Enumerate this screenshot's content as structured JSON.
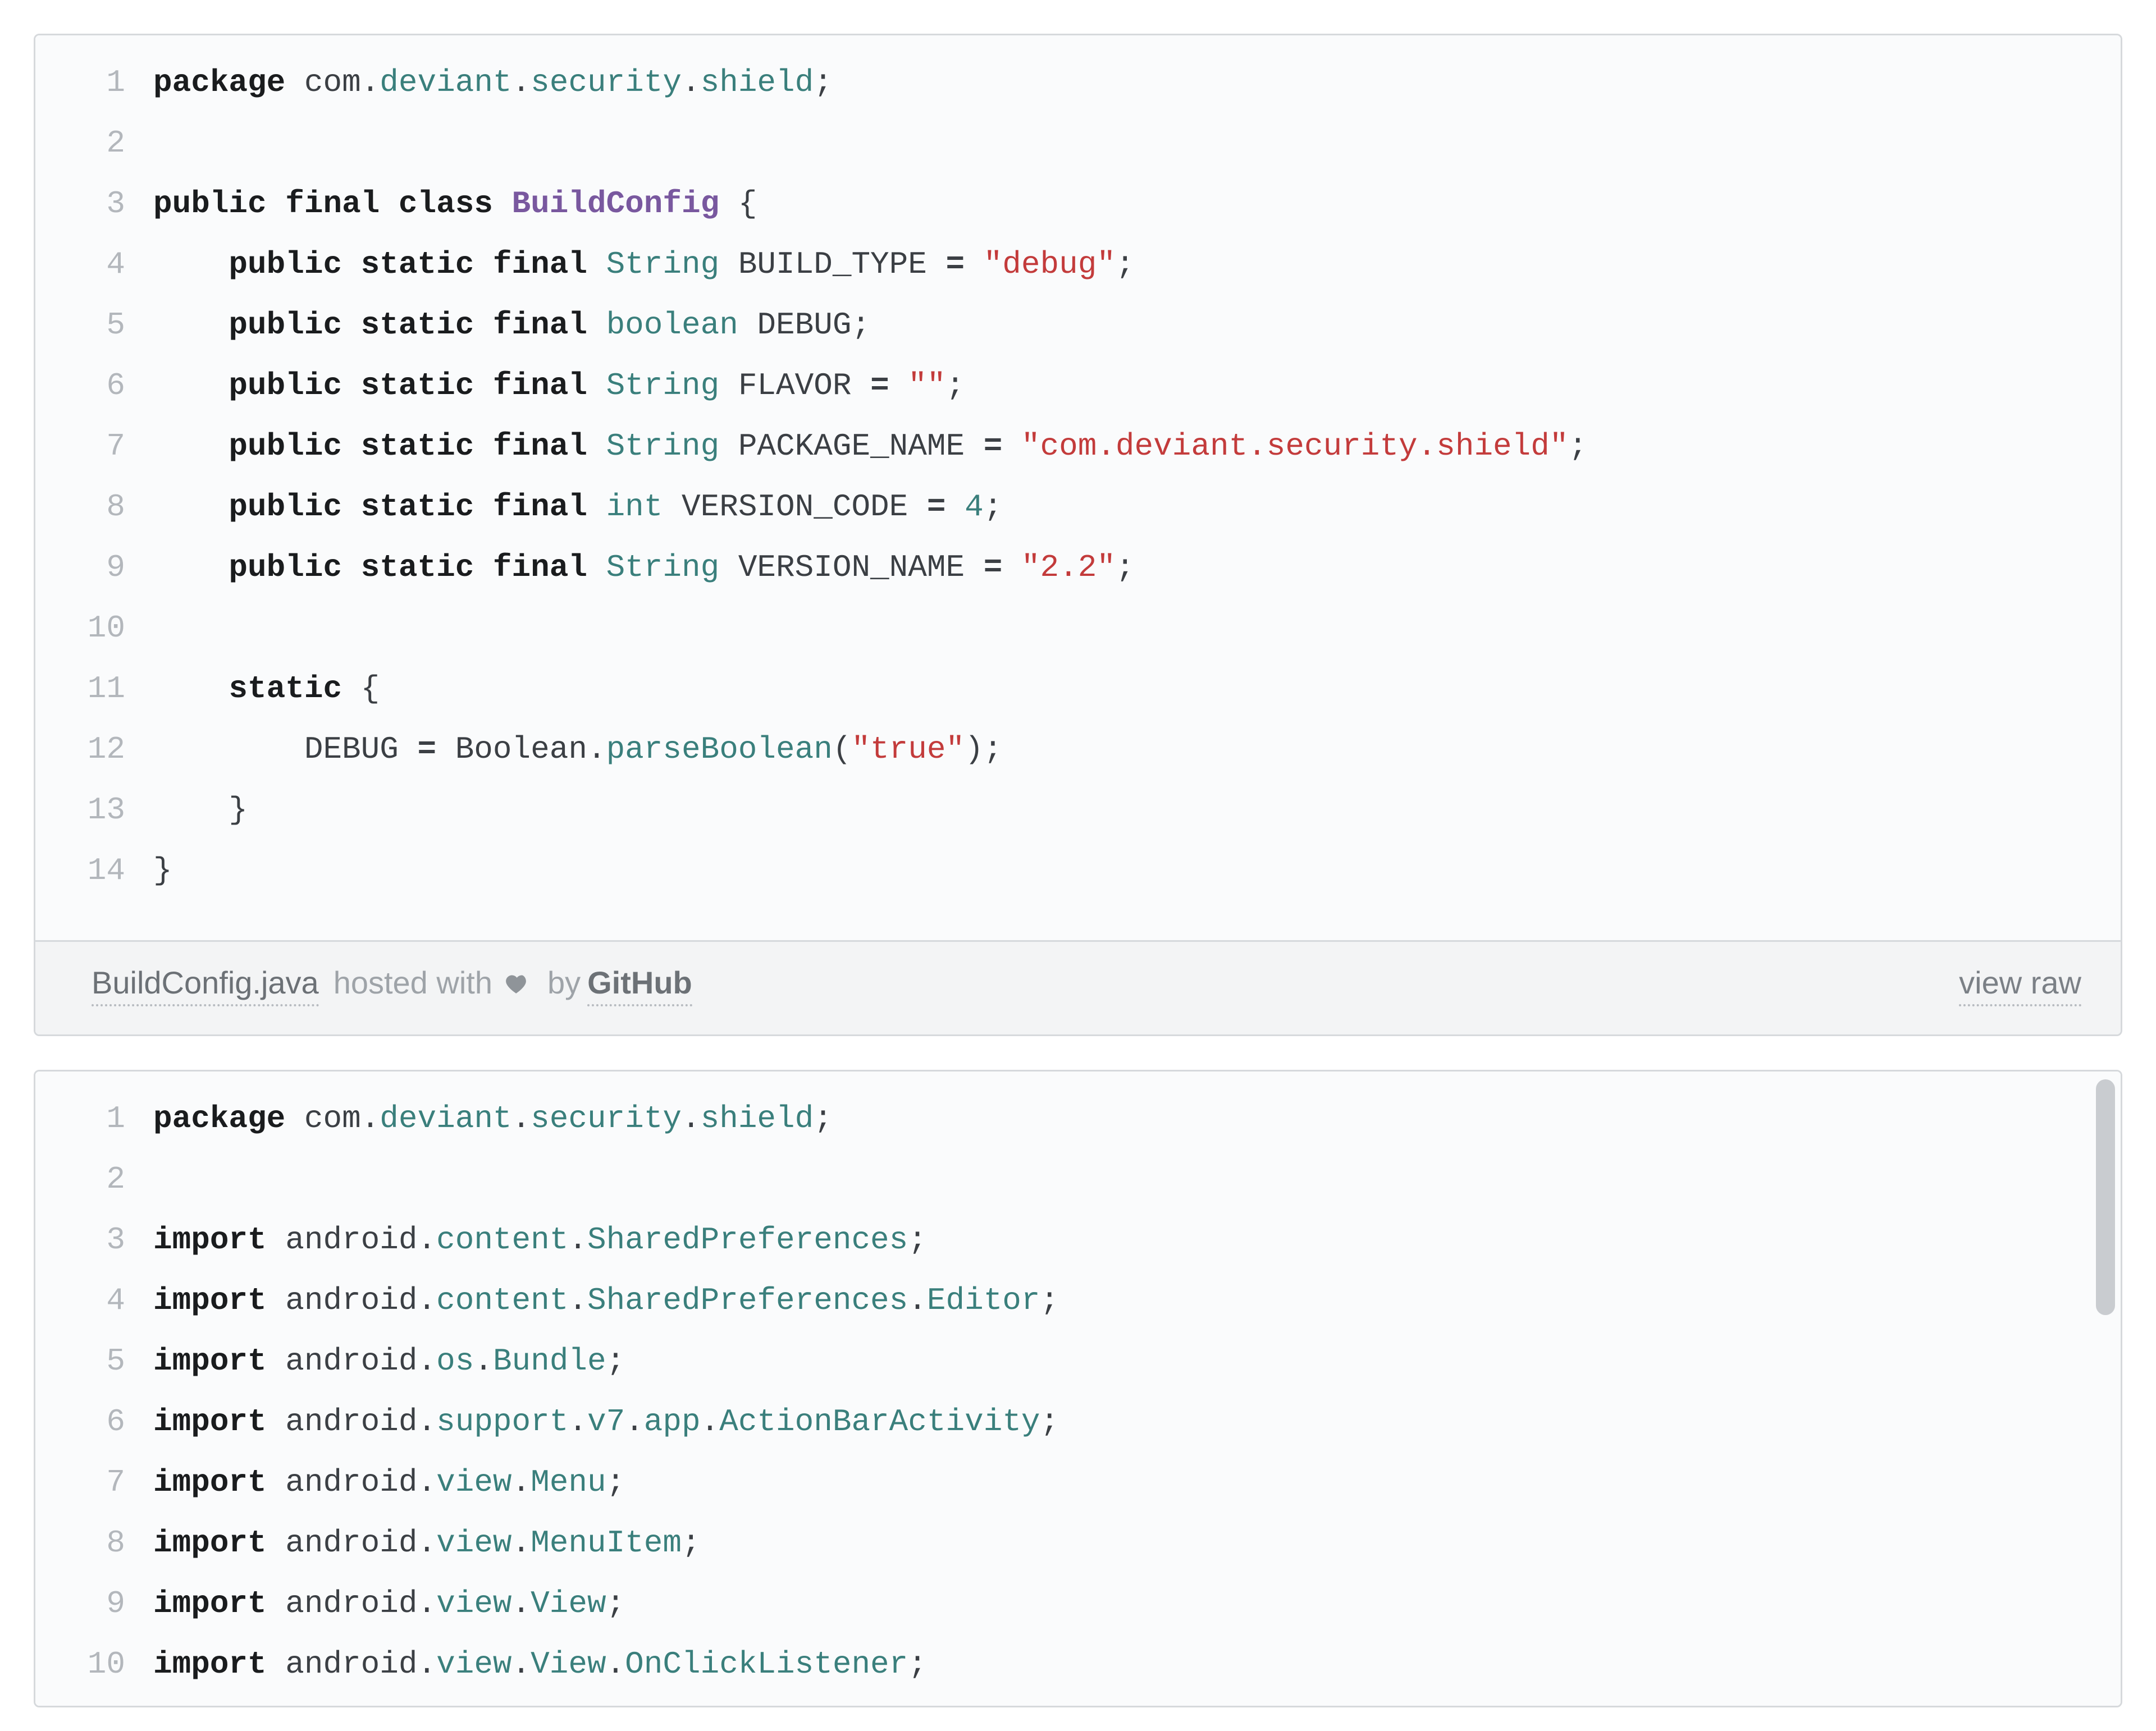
{
  "gists": [
    {
      "footer": {
        "filename": "BuildConfig.java",
        "hosted_prefix": " hosted with ",
        "by_text": " by ",
        "github": "GitHub",
        "view_raw": "view raw"
      },
      "lines": [
        {
          "n": "1",
          "html": "<span class='tok-kw'>package</span> <span class='tok-ident'>com</span><span class='tok-punc'>.</span><span class='tok-pkg'>deviant</span><span class='tok-punc'>.</span><span class='tok-pkg'>security</span><span class='tok-punc'>.</span><span class='tok-pkg'>shield</span><span class='tok-punc'>;</span>"
        },
        {
          "n": "2",
          "html": ""
        },
        {
          "n": "3",
          "html": "<span class='tok-kw'>public</span> <span class='tok-kw'>final</span> <span class='tok-kw'>class</span> <span class='tok-cls'>BuildConfig</span> <span class='tok-punc'>{</span>"
        },
        {
          "n": "4",
          "html": "    <span class='tok-kw'>public</span> <span class='tok-kw'>static</span> <span class='tok-kw'>final</span> <span class='tok-type'>String</span> <span class='tok-ident'>BUILD_TYPE</span> <span class='tok-op'>=</span> <span class='tok-str'>\"debug\"</span><span class='tok-punc'>;</span>"
        },
        {
          "n": "5",
          "html": "    <span class='tok-kw'>public</span> <span class='tok-kw'>static</span> <span class='tok-kw'>final</span> <span class='tok-type'>boolean</span> <span class='tok-ident'>DEBUG</span><span class='tok-punc'>;</span>"
        },
        {
          "n": "6",
          "html": "    <span class='tok-kw'>public</span> <span class='tok-kw'>static</span> <span class='tok-kw'>final</span> <span class='tok-type'>String</span> <span class='tok-ident'>FLAVOR</span> <span class='tok-op'>=</span> <span class='tok-str'>\"\"</span><span class='tok-punc'>;</span>"
        },
        {
          "n": "7",
          "html": "    <span class='tok-kw'>public</span> <span class='tok-kw'>static</span> <span class='tok-kw'>final</span> <span class='tok-type'>String</span> <span class='tok-ident'>PACKAGE_NAME</span> <span class='tok-op'>=</span> <span class='tok-str'>\"com.deviant.security.shield\"</span><span class='tok-punc'>;</span>"
        },
        {
          "n": "8",
          "html": "    <span class='tok-kw'>public</span> <span class='tok-kw'>static</span> <span class='tok-kw'>final</span> <span class='tok-type'>int</span> <span class='tok-ident'>VERSION_CODE</span> <span class='tok-op'>=</span> <span class='tok-num'>4</span><span class='tok-punc'>;</span>"
        },
        {
          "n": "9",
          "html": "    <span class='tok-kw'>public</span> <span class='tok-kw'>static</span> <span class='tok-kw'>final</span> <span class='tok-type'>String</span> <span class='tok-ident'>VERSION_NAME</span> <span class='tok-op'>=</span> <span class='tok-str'>\"2.2\"</span><span class='tok-punc'>;</span>"
        },
        {
          "n": "10",
          "html": ""
        },
        {
          "n": "11",
          "html": "    <span class='tok-kw'>static</span> <span class='tok-punc'>{</span>"
        },
        {
          "n": "12",
          "html": "        <span class='tok-ident'>DEBUG</span> <span class='tok-op'>=</span> <span class='tok-ident'>Boolean</span><span class='tok-punc'>.</span><span class='tok-call'>parseBoolean</span><span class='tok-punc'>(</span><span class='tok-str'>\"true\"</span><span class='tok-punc'>);</span>"
        },
        {
          "n": "13",
          "html": "    <span class='tok-punc'>}</span>"
        },
        {
          "n": "14",
          "html": "<span class='tok-punc'>}</span>"
        }
      ]
    },
    {
      "scrollable": true,
      "lines": [
        {
          "n": "1",
          "html": "<span class='tok-kw'>package</span> <span class='tok-ident'>com</span><span class='tok-punc'>.</span><span class='tok-pkg'>deviant</span><span class='tok-punc'>.</span><span class='tok-pkg'>security</span><span class='tok-punc'>.</span><span class='tok-pkg'>shield</span><span class='tok-punc'>;</span>"
        },
        {
          "n": "2",
          "html": ""
        },
        {
          "n": "3",
          "html": "<span class='tok-kw'>import</span> <span class='tok-ident'>android</span><span class='tok-punc'>.</span><span class='tok-pkg'>content</span><span class='tok-punc'>.</span><span class='tok-pkg'>SharedPreferences</span><span class='tok-punc'>;</span>"
        },
        {
          "n": "4",
          "html": "<span class='tok-kw'>import</span> <span class='tok-ident'>android</span><span class='tok-punc'>.</span><span class='tok-pkg'>content</span><span class='tok-punc'>.</span><span class='tok-pkg'>SharedPreferences</span><span class='tok-punc'>.</span><span class='tok-pkg'>Editor</span><span class='tok-punc'>;</span>"
        },
        {
          "n": "5",
          "html": "<span class='tok-kw'>import</span> <span class='tok-ident'>android</span><span class='tok-punc'>.</span><span class='tok-pkg'>os</span><span class='tok-punc'>.</span><span class='tok-pkg'>Bundle</span><span class='tok-punc'>;</span>"
        },
        {
          "n": "6",
          "html": "<span class='tok-kw'>import</span> <span class='tok-ident'>android</span><span class='tok-punc'>.</span><span class='tok-pkg'>support</span><span class='tok-punc'>.</span><span class='tok-pkg'>v7</span><span class='tok-punc'>.</span><span class='tok-pkg'>app</span><span class='tok-punc'>.</span><span class='tok-pkg'>ActionBarActivity</span><span class='tok-punc'>;</span>"
        },
        {
          "n": "7",
          "html": "<span class='tok-kw'>import</span> <span class='tok-ident'>android</span><span class='tok-punc'>.</span><span class='tok-pkg'>view</span><span class='tok-punc'>.</span><span class='tok-pkg'>Menu</span><span class='tok-punc'>;</span>"
        },
        {
          "n": "8",
          "html": "<span class='tok-kw'>import</span> <span class='tok-ident'>android</span><span class='tok-punc'>.</span><span class='tok-pkg'>view</span><span class='tok-punc'>.</span><span class='tok-pkg'>MenuItem</span><span class='tok-punc'>;</span>"
        },
        {
          "n": "9",
          "html": "<span class='tok-kw'>import</span> <span class='tok-ident'>android</span><span class='tok-punc'>.</span><span class='tok-pkg'>view</span><span class='tok-punc'>.</span><span class='tok-pkg'>View</span><span class='tok-punc'>;</span>"
        },
        {
          "n": "10",
          "html": "<span class='tok-kw'>import</span> <span class='tok-ident'>android</span><span class='tok-punc'>.</span><span class='tok-pkg'>view</span><span class='tok-punc'>.</span><span class='tok-pkg'>View</span><span class='tok-punc'>.</span><span class='tok-pkg'>OnClickListener</span><span class='tok-punc'>;</span>"
        }
      ]
    }
  ]
}
